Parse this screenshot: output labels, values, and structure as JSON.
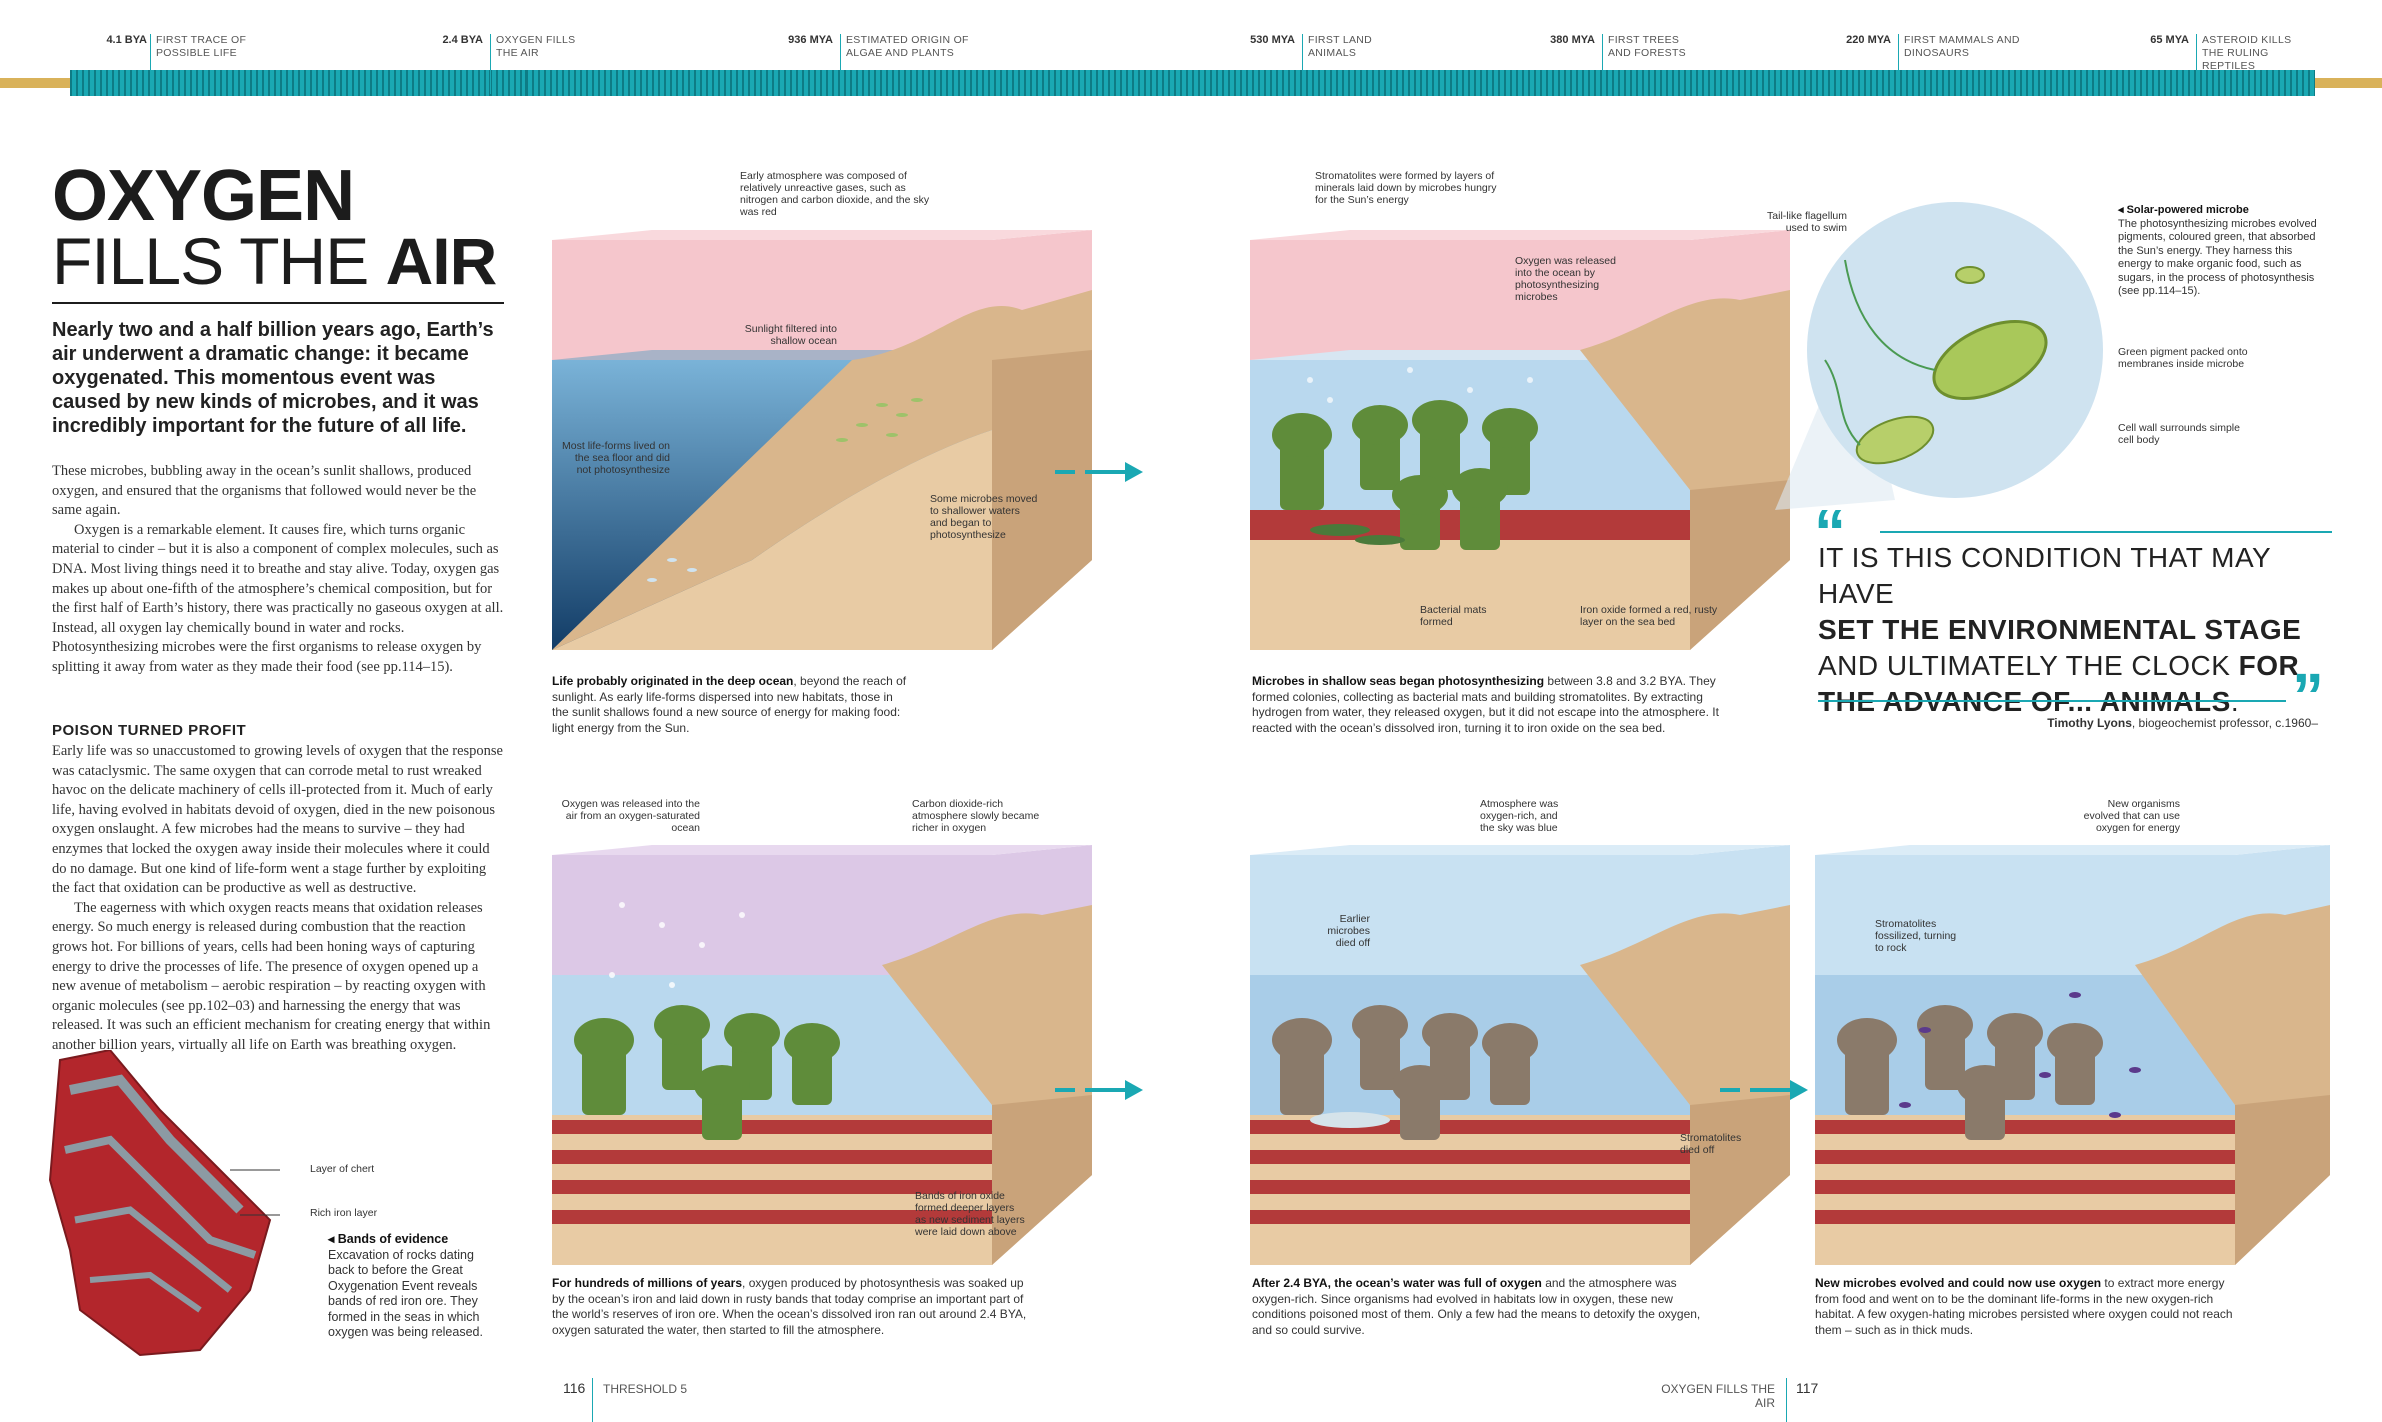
{
  "timeline": [
    {
      "date": "4.1 BYA",
      "label": "FIRST TRACE OF POSSIBLE LIFE"
    },
    {
      "date": "2.4 BYA",
      "label": "OXYGEN FILLS THE AIR"
    },
    {
      "date": "936 MYA",
      "label": "ESTIMATED ORIGIN OF ALGAE AND PLANTS"
    },
    {
      "date": "530 MYA",
      "label": "FIRST LAND ANIMALS"
    },
    {
      "date": "380 MYA",
      "label": "FIRST TREES AND FORESTS"
    },
    {
      "date": "220 MYA",
      "label": "FIRST MAMMALS AND DINOSAURS"
    },
    {
      "date": "65 MYA",
      "label": "ASTEROID KILLS THE RULING REPTILES"
    }
  ],
  "colors": {
    "accent": "#1aa8b3",
    "iron": "#b33a3a",
    "sky": "#f2b8c0",
    "water": "#7fb2d6"
  },
  "title": {
    "line1": "OXYGEN",
    "line2_a": "FILLS THE ",
    "line2_b": "AIR"
  },
  "intro": "Nearly two and a half billion years ago, Earth’s air underwent a dramatic change: it became oxygenated. This momentous event was caused by new kinds of microbes, and it was incredibly important for the future of all life.",
  "body_p1": "These microbes, bubbling away in the ocean’s sunlit shallows, produced oxygen, and ensured that the organisms that followed would never be the same again.",
  "body_p2": "Oxygen is a remarkable element. It causes fire, which turns organic material to cinder – but it is also a component of complex molecules, such as DNA. Most living things need it to breathe and stay alive. Today, oxygen gas makes up about one-fifth of the atmosphere’s chemical composition, but for the first half of Earth’s history, there was practically no gaseous oxygen at all. Instead, all oxygen lay chemically bound in water and rocks. Photosynthesizing microbes were the first organisms to release oxygen by splitting it away from water as they made their food (see pp.114–15).",
  "subhead": "POISON TURNED PROFIT",
  "body_p3": "Early life was so unaccustomed to growing levels of oxygen that the response was cataclysmic. The same oxygen that can corrode metal to rust wreaked havoc on the delicate machinery of cells ill-protected from it. Much of early life, having evolved in habitats devoid of oxygen, died in the new poisonous oxygen onslaught. A few microbes had the means to survive – they had enzymes that locked the oxygen away inside their molecules where it could do no damage. But one kind of life-form went a stage further by exploiting the fact that oxidation can be productive as well as destructive.",
  "body_p4": "The eagerness with which oxygen reacts means that oxidation releases energy. So much energy is released during combustion that the reaction grows hot. For billions of years, cells had been honing ways of capturing energy to drive the processes of life. The presence of oxygen opened up a new avenue of metabolism – aerobic respiration – by reacting oxygen with organic molecules (see pp.102–03) and harnessing the energy that was released. It was such an efficient mechanism for creating energy that within another billion years, virtually all life on Earth was breathing oxygen.",
  "rock": {
    "label_chert": "Layer of chert",
    "label_iron": "Rich iron layer",
    "caption_title": "◂ Bands of evidence",
    "caption": "Excavation of rocks dating back to before the Great Oxygenation Event reveals bands of red iron ore. They formed in the seas in which oxygen was being released."
  },
  "panel1": {
    "ann_top": "Early atmosphere was composed of relatively unreactive gases, such as nitrogen and carbon dioxide, and the sky was red",
    "ann_sun": "Sunlight filtered into shallow ocean",
    "ann_deep": "Most life-forms lived on the sea floor and did not photosynthesize",
    "ann_shallow": "Some microbes moved to shallower waters and began to photosynthesize",
    "cap_bold": "Life probably originated in the deep ocean",
    "cap": ", beyond the reach of sunlight. As early life-forms dispersed into new habitats, those in the sunlit shallows found a new source of energy for making food: light energy from the Sun."
  },
  "panel2": {
    "ann_strom": "Stromatolites were formed by layers of minerals laid down by microbes hungry for the Sun’s energy",
    "ann_oxy": "Oxygen was released into the ocean by photosynthesizing microbes",
    "ann_mats": "Bacterial mats formed",
    "ann_iron": "Iron oxide formed a red, rusty layer on the sea bed",
    "cap_bold": "Microbes in shallow seas began photosynthesizing",
    "cap": " between 3.8 and 3.2 BYA. They formed colonies, collecting as bacterial mats and building stromatolites. By extracting hydrogen from water, they released oxygen, but it did not escape into the atmosphere. It reacted with the ocean’s dissolved iron, turning it to iron oxide on the sea bed."
  },
  "microbe": {
    "ann_flag": "Tail-like flagellum used to swim",
    "title": "◂ Solar-powered microbe",
    "desc": "The photosynthesizing microbes evolved pigments, coloured green, that absorbed the Sun’s energy. They harness this energy to make organic food, such as sugars, in the process of photosynthesis (see pp.114–15).",
    "ann_pigment": "Green pigment packed onto membranes inside microbe",
    "ann_wall": "Cell wall surrounds simple cell body"
  },
  "quote": {
    "t1": "IT IS THIS CONDITION THAT MAY HAVE",
    "t2": "SET THE ENVIRONMENTAL STAGE",
    "t3a": "AND ULTIMATELY THE CLOCK ",
    "t3b": "FOR",
    "t4": "THE ADVANCE OF... ANIMALS",
    "t4end": ".",
    "author": "Timothy Lyons",
    "role": ", biogeochemist professor, c.1960–"
  },
  "panel3": {
    "ann_air": "Oxygen was released into the air from an oxygen-saturated ocean",
    "ann_co2": "Carbon dioxide-rich atmosphere slowly became richer in oxygen",
    "ann_bands": "Bands of iron oxide formed deeper layers as new sediment layers were laid down above",
    "cap_bold": "For hundreds of millions of years",
    "cap": ", oxygen produced by photosynthesis was soaked up by the ocean’s iron and laid down in rusty bands that today comprise an important part of the world’s reserves of iron ore. When the ocean’s dissolved iron ran out around 2.4 BYA, oxygen saturated the water, then started to fill the atmosphere."
  },
  "panel4": {
    "ann_sky": "Atmosphere was oxygen-rich, and the sky was blue",
    "ann_died": "Earlier microbes died off",
    "ann_strom": "Stromatolites died off",
    "cap_bold": "After 2.4 BYA, the ocean’s water was full of oxygen",
    "cap": " and the atmosphere was oxygen-rich. Since organisms had evolved in habitats low in oxygen, these new conditions poisoned most of them. Only a few had the means to detoxify the oxygen, and so could survive."
  },
  "panel5": {
    "ann_new": "New organisms evolved that can use oxygen for energy",
    "ann_fossil": "Stromatolites fossilized, turning to rock",
    "cap_bold": "New microbes evolved and could now use oxygen",
    "cap": " to extract more energy from food and went on to be the dominant life-forms in the new oxygen-rich habitat. A few oxygen-hating microbes persisted where oxygen could not reach them – such as in thick muds."
  },
  "footer": {
    "left_num": "116",
    "left_text": "THRESHOLD 5",
    "right_text": "OXYGEN FILLS THE AIR",
    "right_num": "117"
  }
}
